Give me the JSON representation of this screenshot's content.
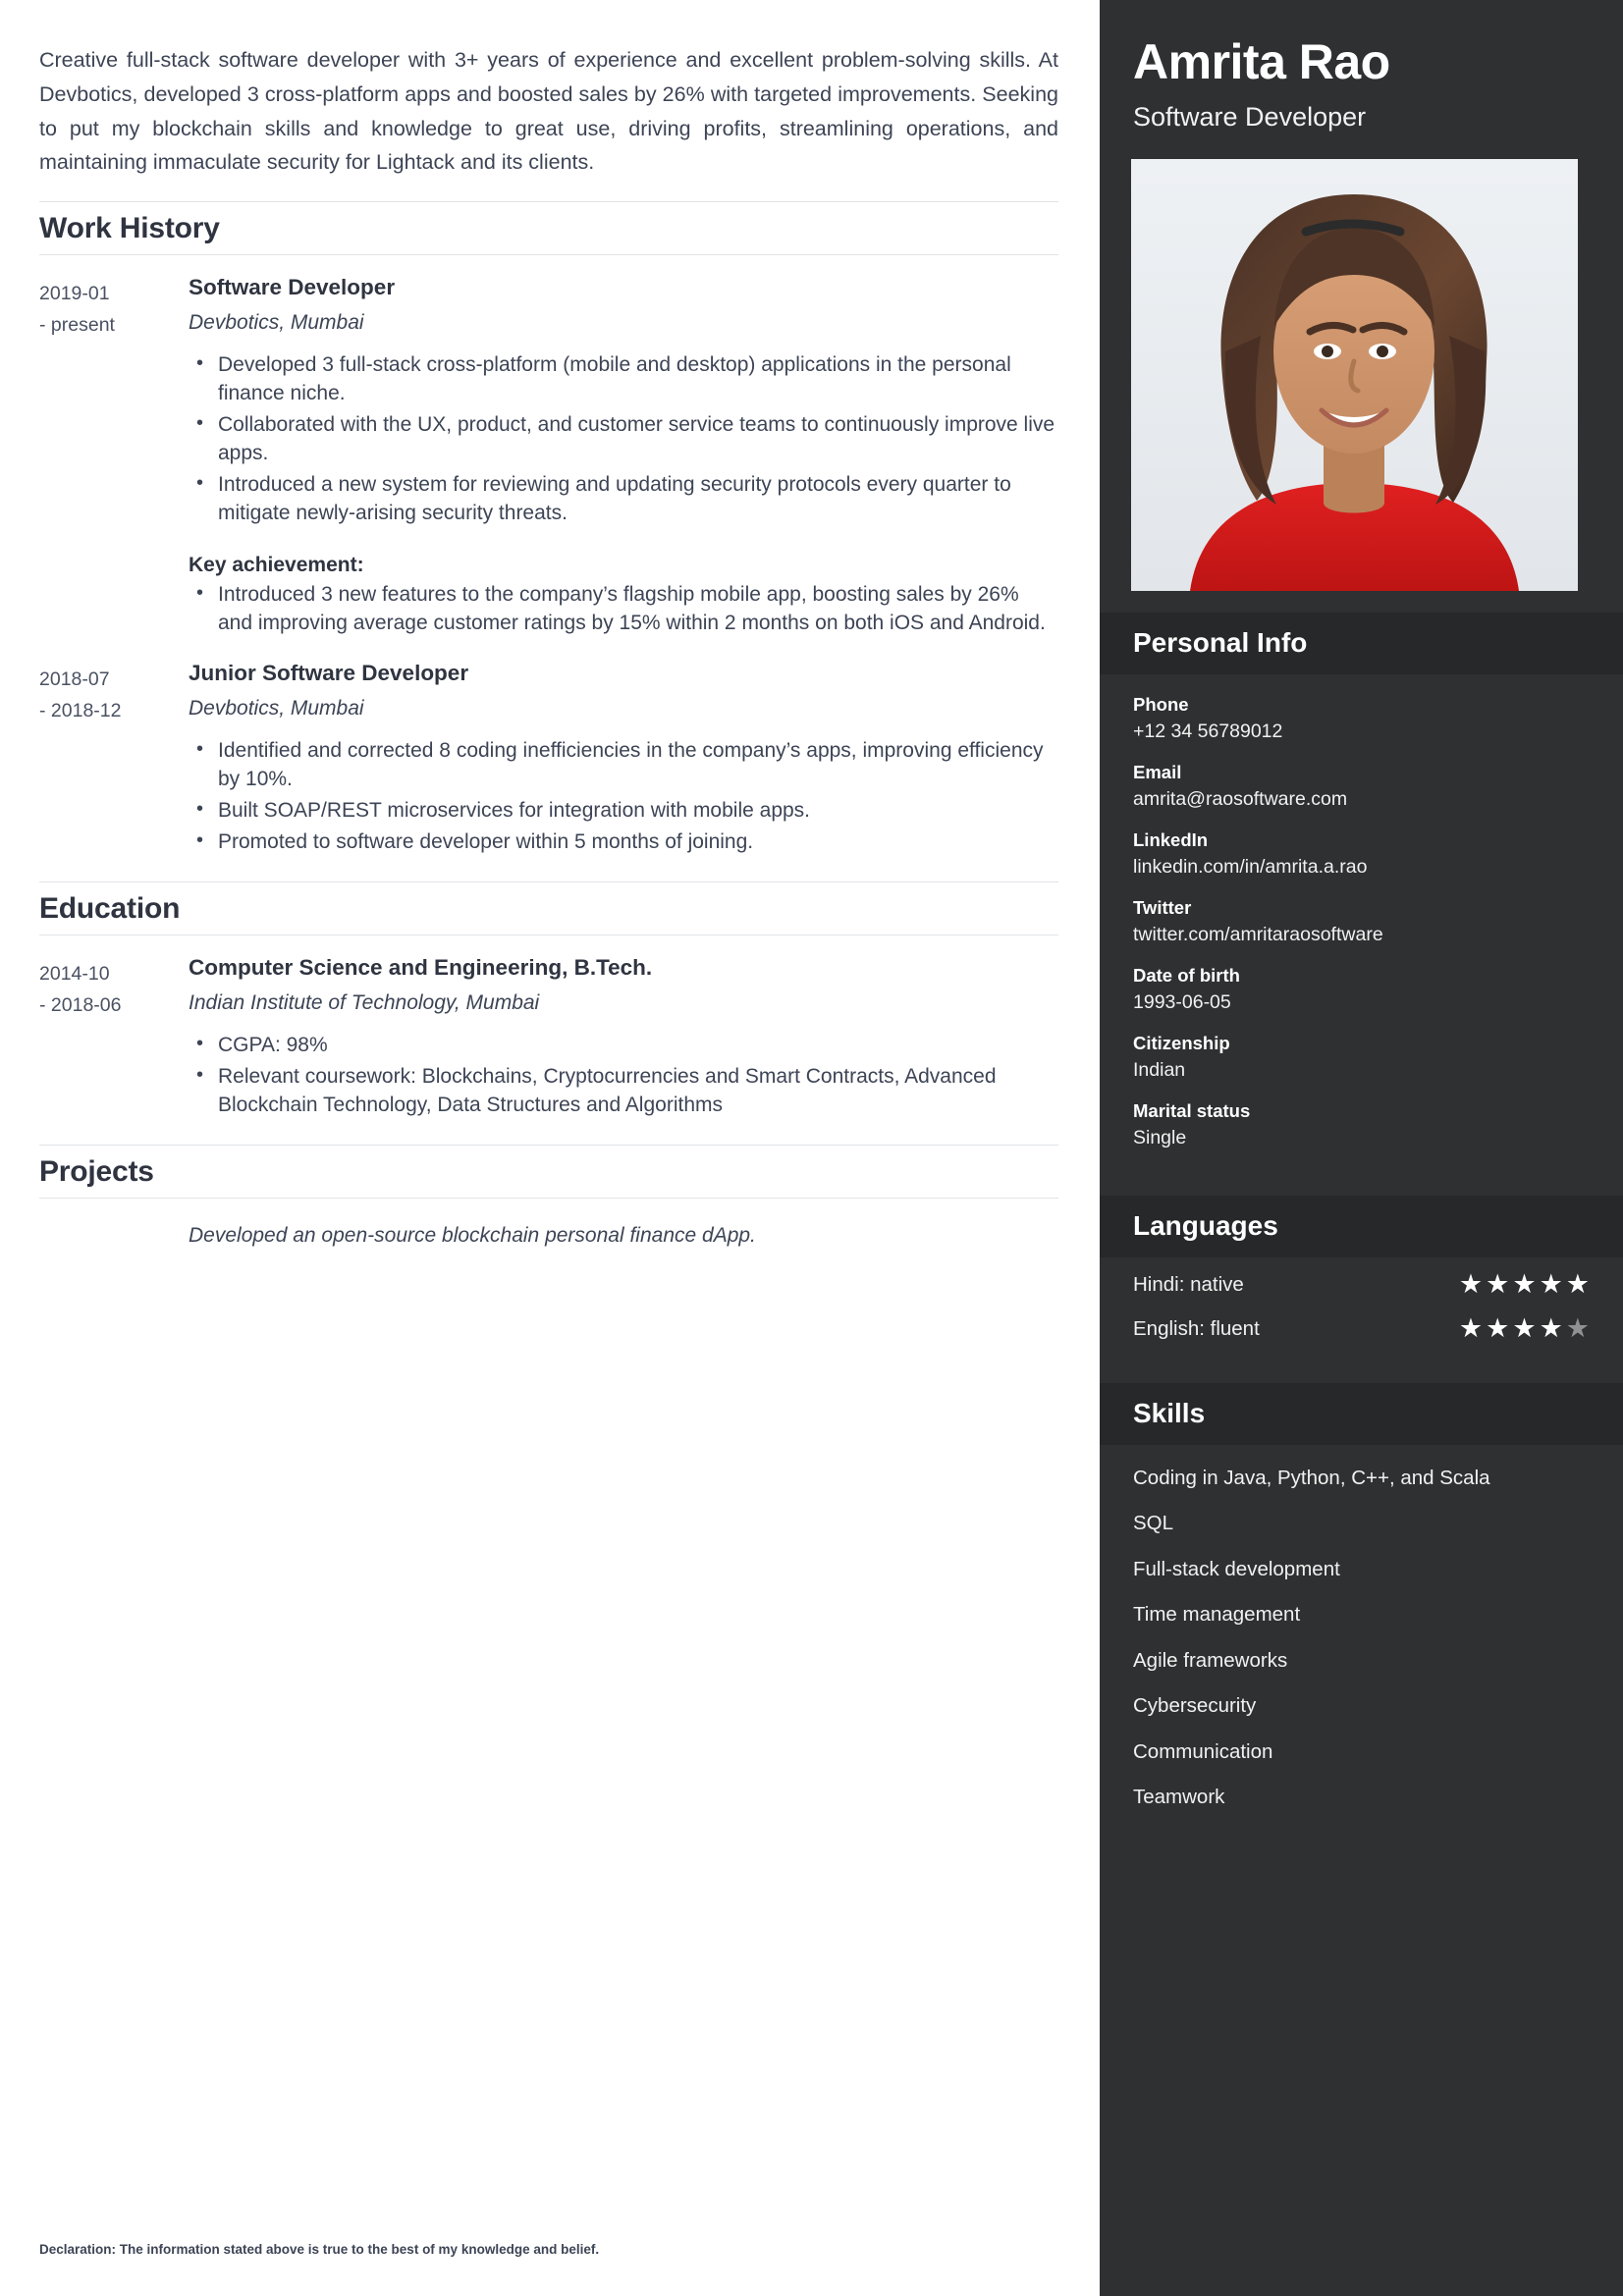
{
  "main": {
    "summary": "Creative full-stack software developer with 3+ years of experience and excellent problem-solving skills. At Devbotics, developed 3 cross-platform apps and boosted sales by 26% with targeted improvements. Seeking to put my blockchain skills and knowledge to great use, driving profits, streamlining operations, and maintaining immaculate security for Lightack and its clients.",
    "sections": {
      "work": {
        "heading": "Work History",
        "entries": [
          {
            "date_start": "2019-01",
            "date_end": "- present",
            "title": "Software Developer",
            "subtitle": "Devbotics, Mumbai",
            "bullets": [
              "Developed 3 full-stack cross-platform (mobile and desktop) applications in the personal finance niche.",
              "Collaborated with the UX, product, and customer service teams to continuously improve live apps.",
              "Introduced a new system for reviewing and updating security protocols every quarter to mitigate newly-arising security threats."
            ],
            "key_achievement_label": "Key achievement:",
            "key_achievement_bullets": [
              "Introduced 3 new features to the company’s flagship mobile app, boosting sales by 26% and improving average customer ratings by 15% within 2 months on both iOS and Android."
            ]
          },
          {
            "date_start": "2018-07",
            "date_end": "- 2018-12",
            "title": "Junior Software Developer",
            "subtitle": "Devbotics, Mumbai",
            "bullets": [
              "Identified and corrected 8 coding inefficiencies in the company’s apps, improving efficiency by 10%.",
              "Built SOAP/REST microservices for integration with mobile apps.",
              "Promoted to software developer within 5 months of joining."
            ]
          }
        ]
      },
      "education": {
        "heading": "Education",
        "entries": [
          {
            "date_start": "2014-10",
            "date_end": "- 2018-06",
            "title": "Computer Science and Engineering, B.Tech.",
            "subtitle": "Indian Institute of Technology, Mumbai",
            "bullets": [
              "CGPA: 98%",
              "Relevant coursework: Blockchains, Cryptocurrencies and Smart Contracts,  Advanced Blockchain Technology, Data Structures and Algorithms"
            ]
          }
        ]
      },
      "projects": {
        "heading": "Projects",
        "text": "Developed an open-source blockchain personal finance dApp."
      }
    },
    "declaration": "Declaration: The information stated above is true to the best of my knowledge and belief."
  },
  "sidebar": {
    "name": "Amrita Rao",
    "role": "Software Developer",
    "photo_alt": "profile-photo",
    "personal_info": {
      "heading": "Personal Info",
      "items": [
        {
          "label": "Phone",
          "value": "+12 34 56789012"
        },
        {
          "label": "Email",
          "value": "amrita@raosoftware.com"
        },
        {
          "label": "LinkedIn",
          "value": "linkedin.com/in/amrita.a.rao"
        },
        {
          "label": "Twitter",
          "value": "twitter.com/amritaraosoftware"
        },
        {
          "label": "Date of birth",
          "value": "1993-06-05"
        },
        {
          "label": "Citizenship",
          "value": "Indian"
        },
        {
          "label": "Marital status",
          "value": "Single"
        }
      ]
    },
    "languages": {
      "heading": "Languages",
      "items": [
        {
          "label": "Hindi: native",
          "rating": 5,
          "max": 5
        },
        {
          "label": "English: fluent",
          "rating": 4,
          "max": 5
        }
      ]
    },
    "skills": {
      "heading": "Skills",
      "items": [
        "Coding in Java, Python, C++, and Scala",
        "SQL",
        "Full-stack development",
        "Time management",
        "Agile frameworks",
        "Cybersecurity",
        "Communication",
        "Teamwork"
      ]
    }
  },
  "colors": {
    "sidebar_bg": "#2f3031",
    "sidebar_head_bg": "#272829",
    "text": "#3d4455",
    "heading": "#2f3440",
    "rule": "#e2e4e8",
    "star_on": "#ffffff",
    "star_off": "#8f9194"
  }
}
